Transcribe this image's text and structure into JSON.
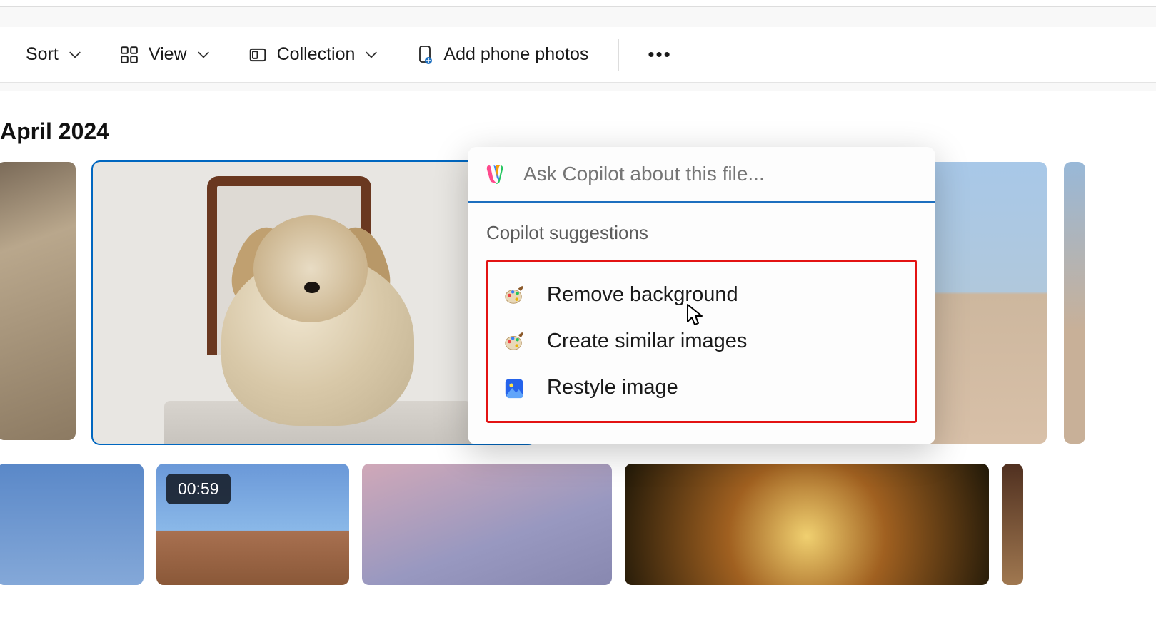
{
  "toolbar": {
    "sort_label": "Sort",
    "view_label": "View",
    "collection_label": "Collection",
    "add_phone_label": "Add phone photos"
  },
  "section": {
    "header": "April 2024"
  },
  "video_badge": "00:59",
  "copilot": {
    "placeholder": "Ask Copilot about this file...",
    "section_title": "Copilot suggestions",
    "suggestions": [
      {
        "icon": "palette-icon",
        "label": "Remove background"
      },
      {
        "icon": "palette-icon",
        "label": "Create similar images"
      },
      {
        "icon": "photo-icon",
        "label": "Restyle image"
      }
    ]
  }
}
